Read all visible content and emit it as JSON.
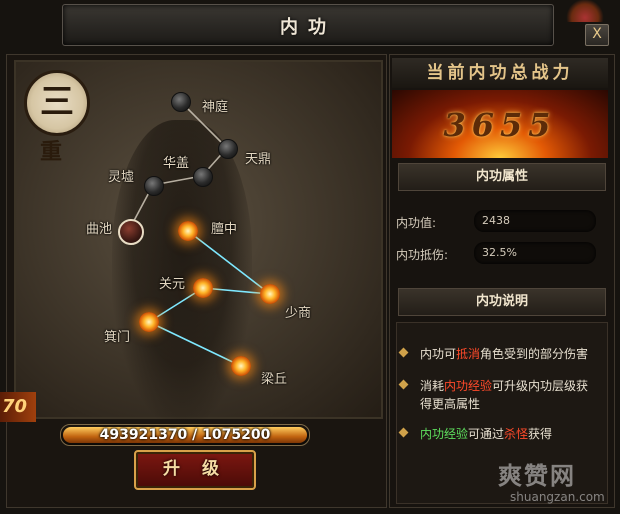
{
  "window": {
    "title": "内功",
    "close_label": "X"
  },
  "rank": {
    "level_char": "三",
    "sub_char": "重"
  },
  "meridian_nodes": [
    {
      "label": "神庭",
      "state": "inactive"
    },
    {
      "label": "天鼎",
      "state": "inactive"
    },
    {
      "label": "华盖",
      "state": "inactive"
    },
    {
      "label": "灵墟",
      "state": "inactive"
    },
    {
      "label": "曲池",
      "state": "selected"
    },
    {
      "label": "膻中",
      "state": "active"
    },
    {
      "label": "关元",
      "state": "active"
    },
    {
      "label": "少商",
      "state": "active"
    },
    {
      "label": "箕门",
      "state": "active"
    },
    {
      "label": "梁丘",
      "state": "active"
    }
  ],
  "combat_tag": "70",
  "experience": {
    "current": 493921370,
    "required": 1075200,
    "text": "493921370 / 1075200",
    "fill_fraction": 1.0
  },
  "upgrade_button": "升 级",
  "power": {
    "header": "当前内功总战力",
    "value": "3655"
  },
  "attributes": {
    "header": "内功属性",
    "rows": [
      {
        "label": "内功值:",
        "value": "2438"
      },
      {
        "label": "内功抵伤:",
        "value": "32.5%"
      }
    ]
  },
  "description": {
    "header": "内功说明",
    "items": [
      {
        "parts": [
          {
            "text": "内功可",
            "style": "normal"
          },
          {
            "text": "抵消",
            "style": "red"
          },
          {
            "text": "角色受到的部分伤害",
            "style": "normal"
          }
        ]
      },
      {
        "parts": [
          {
            "text": "消耗",
            "style": "normal"
          },
          {
            "text": "内功经验",
            "style": "red"
          },
          {
            "text": "可升级内功层级获得更高属性",
            "style": "normal"
          }
        ]
      },
      {
        "parts": [
          {
            "text": "内功经验",
            "style": "green"
          },
          {
            "text": "可通过",
            "style": "normal"
          },
          {
            "text": "杀怪",
            "style": "red"
          },
          {
            "text": "获得",
            "style": "normal"
          }
        ]
      }
    ]
  },
  "watermark": {
    "brand": "爽赞网",
    "url": "shuangzan.com"
  },
  "colors": {
    "accent_gold": "#d9a14a",
    "highlight_red": "#ff4a2a",
    "highlight_green": "#5ee05e",
    "link_line": "#7ee8ff"
  }
}
